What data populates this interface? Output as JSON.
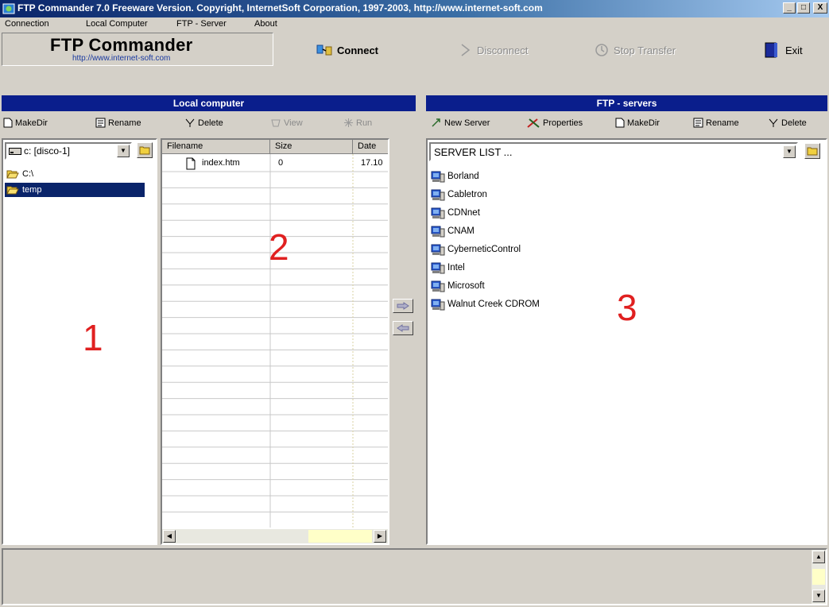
{
  "window": {
    "title": "FTP Commander 7.0 Freeware Version. Copyright, InternetSoft Corporation, 1997-2003, http://www.internet-soft.com",
    "controls": {
      "minimize": "_",
      "maximize": "□",
      "close": "X"
    }
  },
  "menu": [
    "Connection",
    "Local Computer",
    "FTP - Server",
    "About"
  ],
  "header": {
    "logo_title": "FTP Commander",
    "logo_url": "http://www.internet-soft.com",
    "connect": "Connect",
    "disconnect": "Disconnect",
    "stop_transfer": "Stop Transfer",
    "exit": "Exit"
  },
  "local": {
    "section_title": "Local computer",
    "toolbar": {
      "makedir": "MakeDir",
      "rename": "Rename",
      "delete": "Delete",
      "view": "View",
      "run": "Run"
    },
    "drive": "c: [disco-1]",
    "tree": [
      {
        "label": "C:\\"
      },
      {
        "label": "temp"
      }
    ],
    "columns": [
      "Filename",
      "Size",
      "Date"
    ],
    "files": [
      {
        "name": "index.htm",
        "size": "0",
        "date": "17.10"
      }
    ]
  },
  "servers": {
    "section_title": "FTP - servers",
    "toolbar": {
      "new_server": "New Server",
      "properties": "Properties",
      "makedir": "MakeDir",
      "rename": "Rename",
      "delete": "Delete"
    },
    "combo": "SERVER LIST ...",
    "list": [
      "Borland",
      "Cabletron",
      "CDNnet",
      "CNAM",
      "CyberneticControl",
      "Intel",
      "Microsoft",
      "Walnut Creek CDROM"
    ]
  },
  "annotations": {
    "one": "1",
    "two": "2",
    "three": "3"
  },
  "colors": {
    "section_header": "#0a1e8c",
    "selection": "#0a246a",
    "annotation": "#e02020",
    "face": "#d4d0c8"
  }
}
